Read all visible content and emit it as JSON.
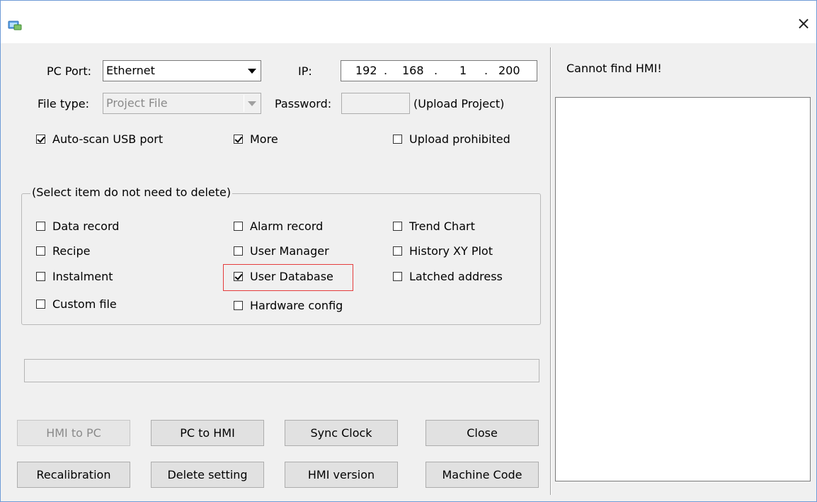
{
  "window": {
    "close_glyph": "×",
    "icon": "app-icon"
  },
  "pc_port": {
    "label": "PC Port:",
    "value": "Ethernet"
  },
  "ip": {
    "label": "IP:",
    "octets": [
      "192",
      "168",
      "1",
      "200"
    ],
    "sep": "."
  },
  "file_type": {
    "label": "File type:",
    "value": "Project File"
  },
  "password": {
    "label": "Password:",
    "value": "",
    "note": "(Upload Project)"
  },
  "options": {
    "auto_scan_usb": {
      "label": "Auto-scan USB port",
      "checked": true
    },
    "more": {
      "label": "More",
      "checked": true
    },
    "upload_prohibited": {
      "label": "Upload prohibited",
      "checked": false
    }
  },
  "delete_group": {
    "title": "(Select item do not need to delete)",
    "items": [
      {
        "label": "Data record",
        "checked": false
      },
      {
        "label": "Recipe",
        "checked": false
      },
      {
        "label": "Instalment",
        "checked": false
      },
      {
        "label": "Custom file",
        "checked": false
      },
      {
        "label": "Alarm record",
        "checked": false
      },
      {
        "label": "User Manager",
        "checked": false
      },
      {
        "label": "User Database",
        "checked": true
      },
      {
        "label": "Hardware config",
        "checked": false
      },
      {
        "label": "Trend Chart",
        "checked": false
      },
      {
        "label": "History XY Plot",
        "checked": false
      },
      {
        "label": "Latched address",
        "checked": false
      }
    ]
  },
  "progress": {
    "value": 0
  },
  "buttons": {
    "hmi_to_pc": "HMI to PC",
    "pc_to_hmi": "PC to HMI",
    "sync_clock": "Sync Clock",
    "close": "Close",
    "recalibration": "Recalibration",
    "delete_setting": "Delete setting",
    "hmi_version": "HMI version",
    "machine_code": "Machine Code"
  },
  "status": {
    "text": "Cannot find HMI!"
  },
  "colors": {
    "highlight": "#e43c3c",
    "window_border": "#6f9bd6",
    "disabled_text": "#8a8a8a"
  }
}
